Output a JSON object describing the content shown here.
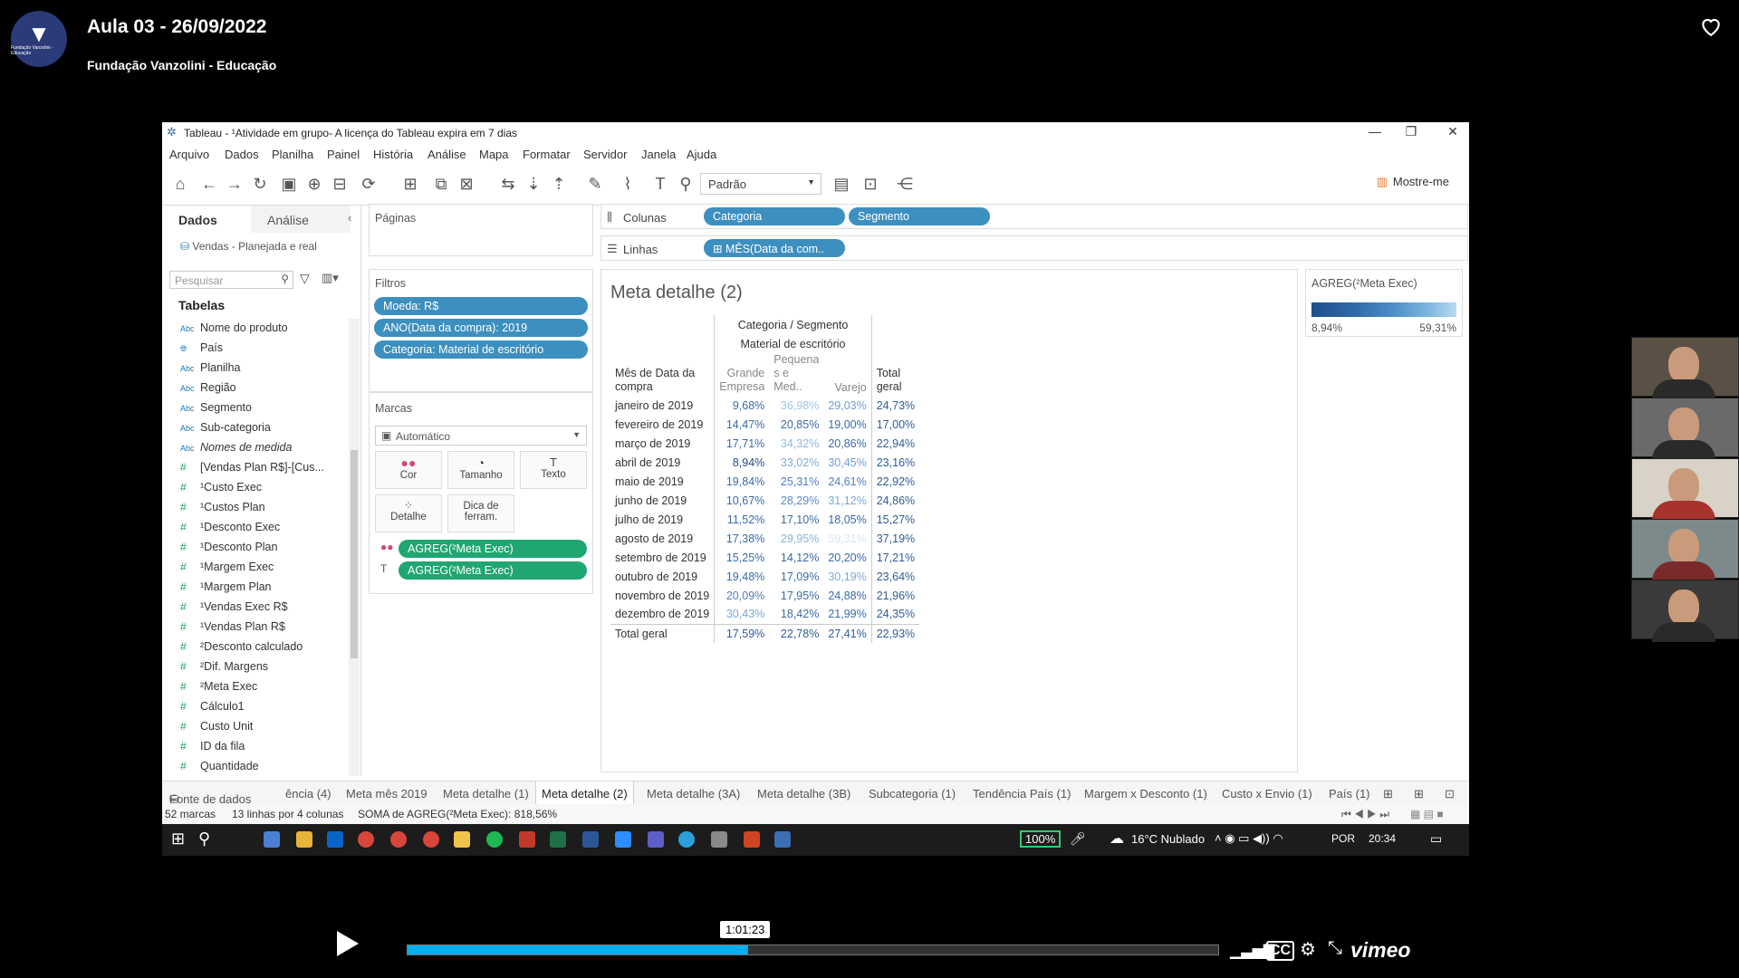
{
  "video": {
    "title": "Aula 03 - 26/09/2022",
    "subtitle": "Fundação Vanzolini - Educação",
    "timecode": "1:01:23",
    "progress": 0.42,
    "brand": "vimeo"
  },
  "window": {
    "title": "Tableau - ¹Atividade em grupo- A licença do Tableau expira em 7 dias",
    "menu": [
      "Arquivo",
      "Dados",
      "Planilha",
      "Painel",
      "História",
      "Análise",
      "Mapa",
      "Formatar",
      "Servidor",
      "Janela",
      "Ajuda"
    ],
    "show_me": "Mostre-me",
    "zoom_select": "Padrão"
  },
  "datapane": {
    "tab_data": "Dados",
    "tab_analysis": "Análise",
    "datasource": "Vendas - Planejada e real",
    "search_placeholder": "Pesquisar",
    "tables_label": "Tabelas",
    "fields": [
      {
        "type": "Abc",
        "name": "Nome do produto"
      },
      {
        "type": "geo",
        "name": "País"
      },
      {
        "type": "Abc",
        "name": "Planilha"
      },
      {
        "type": "Abc",
        "name": "Região"
      },
      {
        "type": "Abc",
        "name": "Segmento"
      },
      {
        "type": "Abc",
        "name": "Sub-categoria"
      },
      {
        "type": "Abc",
        "name": "Nomes de medida"
      },
      {
        "type": "#",
        "name": "[Vendas Plan R$]-[Cus..."
      },
      {
        "type": "#",
        "name": "¹Custo Exec"
      },
      {
        "type": "#",
        "name": "¹Custos Plan"
      },
      {
        "type": "#",
        "name": "¹Desconto Exec"
      },
      {
        "type": "#",
        "name": "¹Desconto Plan"
      },
      {
        "type": "#",
        "name": "¹Margem Exec"
      },
      {
        "type": "#",
        "name": "¹Margem Plan"
      },
      {
        "type": "#",
        "name": "¹Vendas Exec R$"
      },
      {
        "type": "#",
        "name": "¹Vendas Plan R$"
      },
      {
        "type": "#",
        "name": "²Desconto calculado"
      },
      {
        "type": "#",
        "name": "²Dif. Margens"
      },
      {
        "type": "#",
        "name": "²Meta Exec"
      },
      {
        "type": "#",
        "name": "Cálculo1"
      },
      {
        "type": "#",
        "name": "Custo Unit"
      },
      {
        "type": "#",
        "name": "ID da fila"
      },
      {
        "type": "#",
        "name": "Quantidade"
      }
    ]
  },
  "cards": {
    "pages": "Páginas",
    "filters": "Filtros",
    "filter_pills": [
      "Moeda: R$",
      "ANO(Data da compra): 2019",
      "Categoria: Material de escritório"
    ],
    "marks": "Marcas",
    "marks_type": "Automático",
    "mark_buttons": [
      "Cor",
      "Tamanho",
      "Texto",
      "Detalhe",
      "Dica de ferram."
    ],
    "mark_pills": [
      "AGREG(²Meta Exec)",
      "AGREG(²Meta Exec)"
    ]
  },
  "shelves": {
    "columns_label": "Colunas",
    "columns": [
      "Categoria",
      "Segmento"
    ],
    "rows_label": "Linhas",
    "rows": [
      "MÊS(Data da com.."
    ]
  },
  "viz": {
    "title": "Meta detalhe (2)",
    "header_top": "Categoria / Segmento",
    "header_cat": "Material de escritório",
    "row_header": "Mês de Data da compra",
    "col_headers": [
      "Grande Empresa",
      "Pequena s e Med..",
      "Varejo",
      "Total geral"
    ],
    "rows": [
      [
        "janeiro de 2019",
        "9,68%",
        "36,98%",
        "29,03%",
        "24,73%"
      ],
      [
        "fevereiro de 2019",
        "14,47%",
        "20,85%",
        "19,00%",
        "17,00%"
      ],
      [
        "março de 2019",
        "17,71%",
        "34,32%",
        "20,86%",
        "22,94%"
      ],
      [
        "abril de 2019",
        "8,94%",
        "33,02%",
        "30,45%",
        "23,16%"
      ],
      [
        "maio de 2019",
        "19,84%",
        "25,31%",
        "24,61%",
        "22,92%"
      ],
      [
        "junho de 2019",
        "10,67%",
        "28,29%",
        "31,12%",
        "24,86%"
      ],
      [
        "julho de 2019",
        "11,52%",
        "17,10%",
        "18,05%",
        "15,27%"
      ],
      [
        "agosto de 2019",
        "17,38%",
        "29,95%",
        "59,31%",
        "37,19%"
      ],
      [
        "setembro de 2019",
        "15,25%",
        "14,12%",
        "20,20%",
        "17,21%"
      ],
      [
        "outubro de 2019",
        "19,48%",
        "17,09%",
        "30,19%",
        "23,64%"
      ],
      [
        "novembro de 2019",
        "20,09%",
        "17,95%",
        "24,88%",
        "21,96%"
      ],
      [
        "dezembro de 2019",
        "30,43%",
        "18,42%",
        "21,99%",
        "24,35%"
      ],
      [
        "Total geral",
        "17,59%",
        "22,78%",
        "27,41%",
        "22,93%"
      ]
    ],
    "cell_colors": [
      [
        "#3a6aa8",
        "#9fc5e8",
        "#6f9fd1",
        "#2f5d99"
      ],
      [
        "#3a6aa8",
        "#3a6aa8",
        "#3a6aa8",
        "#2f5d99"
      ],
      [
        "#3a6aa8",
        "#8ab8e0",
        "#3a6aa8",
        "#2f5d99"
      ],
      [
        "#1f4e8c",
        "#7eaedc",
        "#6f9fd1",
        "#2f5d99"
      ],
      [
        "#3a6aa8",
        "#4f80bd",
        "#4f80bd",
        "#2f5d99"
      ],
      [
        "#3a6aa8",
        "#5a8ac6",
        "#7aa9d8",
        "#2f5d99"
      ],
      [
        "#3a6aa8",
        "#3a6aa8",
        "#3a6aa8",
        "#2f5d99"
      ],
      [
        "#3a6aa8",
        "#86b4de",
        "#d6e7f5",
        "#2f5d99"
      ],
      [
        "#3a6aa8",
        "#3a6aa8",
        "#3a6aa8",
        "#2f5d99"
      ],
      [
        "#3a6aa8",
        "#3a6aa8",
        "#7aa9d8",
        "#2f5d99"
      ],
      [
        "#4f80bd",
        "#3a6aa8",
        "#3a6aa8",
        "#2f5d99"
      ],
      [
        "#7aa9d8",
        "#3a6aa8",
        "#3a6aa8",
        "#2f5d99"
      ],
      [
        "#2f5d99",
        "#2f5d99",
        "#2f5d99",
        "#2f5d99"
      ]
    ]
  },
  "legend": {
    "title": "AGREG(²Meta Exec)",
    "min": "8,94%",
    "max": "59,31%"
  },
  "sheet_tabs": [
    "Fonte de dados",
    "ência (4)",
    "Meta mês 2019",
    "Meta detalhe (1)",
    "Meta detalhe (2)",
    "Meta detalhe (3A)",
    "Meta detalhe (3B)",
    "Subcategoria (1)",
    "Tendência País (1)",
    "Margem x Desconto (1)",
    "Custo x Envio (1)",
    "País (1)"
  ],
  "status": {
    "marks": "52 marcas",
    "rows": "13 linhas por 4 colunas",
    "sum": "SOMA de AGREG(²Meta Exec): 818,56%"
  },
  "taskbar": {
    "zoom": "100%",
    "weather": "16°C  Nublado",
    "lang": "POR",
    "time": "20:34"
  }
}
